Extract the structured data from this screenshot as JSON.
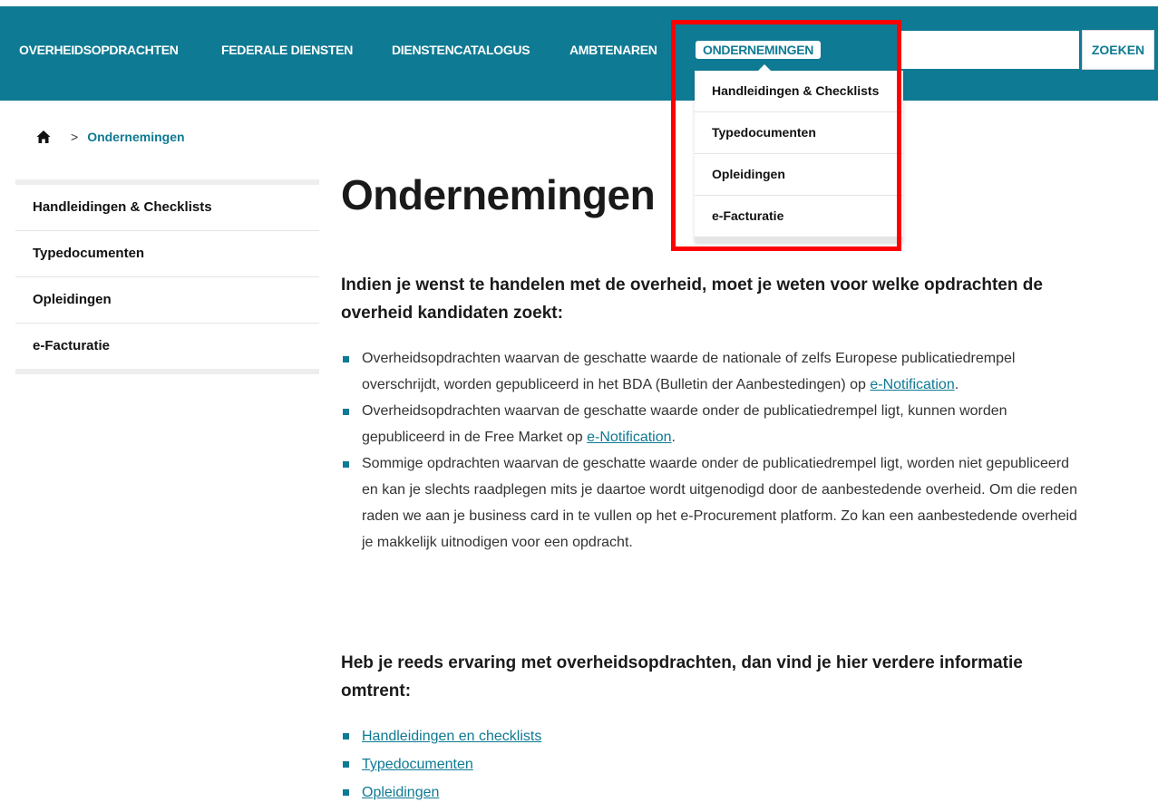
{
  "nav": {
    "items": [
      "OVERHEIDSOPDRACHTEN",
      "FEDERALE DIENSTEN",
      "DIENSTENCATALOGUS",
      "AMBTENAREN"
    ],
    "active": "ONDERNEMINGEN",
    "search_placeholder": "",
    "search_button": "ZOEKEN",
    "accent_color": "#0f7a93"
  },
  "dropdown": {
    "items": [
      "Handleidingen & Checklists",
      "Typedocumenten",
      "Opleidingen",
      "e-Facturatie"
    ],
    "highlight_color": "#ff0000"
  },
  "breadcrumb": {
    "home_icon": "home-icon",
    "separator": ">",
    "current": "Ondernemingen"
  },
  "sidebar": {
    "items": [
      "Handleidingen & Checklists",
      "Typedocumenten",
      "Opleidingen",
      "e-Facturatie"
    ]
  },
  "main": {
    "title": "Ondernemingen",
    "heading1": "Indien je wenst te handelen met de overheid, moet je weten voor welke opdrachten de overheid kandidaten zoekt:",
    "bullets": [
      {
        "text": "Overheidsopdrachten waarvan de geschatte waarde de nationale of zelfs Europese publicatiedrempel overschrijdt, worden gepubliceerd in het BDA (Bulletin der Aanbestedingen) op ",
        "link": "e-Notification",
        "after": "."
      },
      {
        "text": "Overheidsopdrachten waarvan de geschatte waarde onder de publicatiedrempel ligt, kunnen worden gepubliceerd in de Free Market op ",
        "link": "e-Notification",
        "after": "."
      },
      {
        "text": "Sommige opdrachten waarvan de geschatte waarde onder de publicatiedrempel ligt, worden niet gepubliceerd en kan je slechts raadplegen mits je daartoe wordt uitgenodigd door de aanbestedende overheid. Om die reden raden we aan je business card in te vullen op het e-Procurement platform. Zo kan een aanbestedende overheid je makkelijk uitnodigen voor een opdracht."
      }
    ],
    "heading2": "Heb je reeds ervaring met overheidsopdrachten, dan vind je hier verdere informatie omtrent:",
    "links": [
      "Handleidingen en checklists",
      "Typedocumenten",
      "Opleidingen"
    ]
  }
}
